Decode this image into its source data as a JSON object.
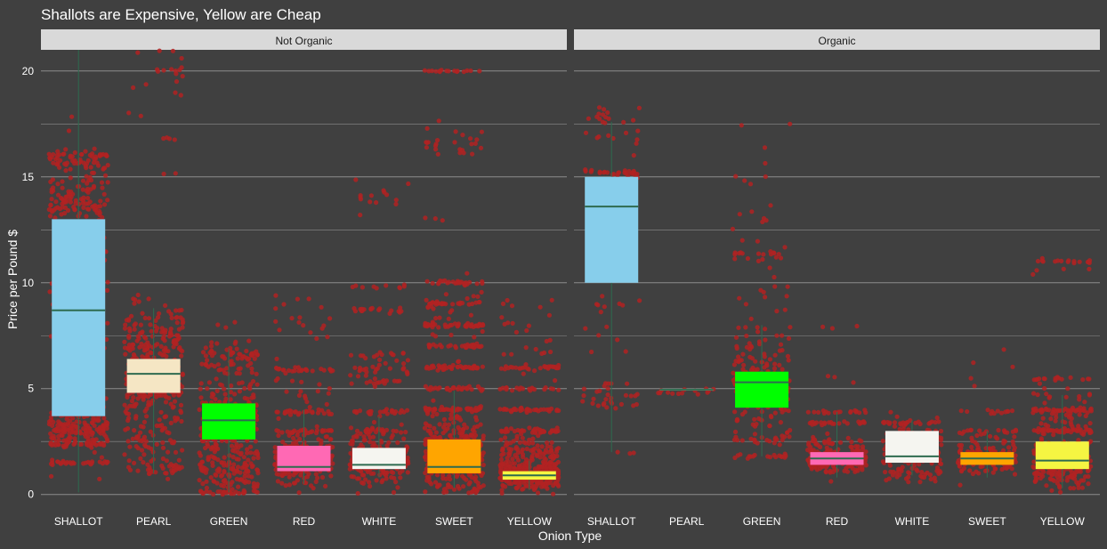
{
  "chart_data": {
    "type": "boxplot",
    "title": "Shallots are Expensive, Yellow are Cheap",
    "xlabel": "Onion Type",
    "ylabel": "Price per Pound $",
    "ylim": [
      -0.6,
      21.0
    ],
    "yticks": [
      0,
      5,
      10,
      15,
      20
    ],
    "grid": true,
    "categories": [
      "SHALLOT",
      "PEARL",
      "GREEN",
      "RED",
      "WHITE",
      "SWEET",
      "YELLOW"
    ],
    "colors": {
      "background": "#404040",
      "strip": "#d9d9d9",
      "grid": "#8c8c8c",
      "points": "#b22222",
      "median": "#2e6b4f",
      "whisker": "#2e6b4f",
      "fills": {
        "SHALLOT": "#87ceeb",
        "PEARL": "#f5e6c4",
        "GREEN": "#00ff00",
        "RED": "#ff69b4",
        "WHITE": "#f5f5f0",
        "SWEET": "#ffa500",
        "YELLOW": "#f5f542"
      }
    },
    "panels": [
      {
        "label": "Not Organic",
        "boxes": [
          {
            "category": "SHALLOT",
            "lower": 0.1,
            "q1": 3.7,
            "median": 8.7,
            "q3": 13.0,
            "upper": 21.0
          },
          {
            "category": "PEARL",
            "lower": 1.0,
            "q1": 4.8,
            "median": 5.7,
            "q3": 6.4,
            "upper": 8.8
          },
          {
            "category": "GREEN",
            "lower": 0.1,
            "q1": 2.6,
            "median": 3.5,
            "q3": 4.3,
            "upper": 6.9
          },
          {
            "category": "RED",
            "lower": 0.5,
            "q1": 1.1,
            "median": 1.3,
            "q3": 2.3,
            "upper": 4.0
          },
          {
            "category": "WHITE",
            "lower": 0.8,
            "q1": 1.2,
            "median": 1.4,
            "q3": 2.2,
            "upper": 3.7
          },
          {
            "category": "SWEET",
            "lower": 0.3,
            "q1": 1.0,
            "median": 1.3,
            "q3": 2.6,
            "upper": 4.9
          },
          {
            "category": "YELLOW",
            "lower": 0.2,
            "q1": 0.7,
            "median": 0.9,
            "q3": 1.1,
            "upper": 1.6
          }
        ],
        "points": [
          {
            "category": "SHALLOT",
            "clusters": [
              [
                1.5,
                0.05,
                30
              ],
              [
                2.4,
                0.1,
                35
              ],
              [
                3.1,
                0.4,
                140
              ],
              [
                4.2,
                0.3,
                40
              ],
              [
                10.0,
                3.0,
                120
              ],
              [
                13.5,
                0.3,
                50
              ],
              [
                14.5,
                0.5,
                45
              ],
              [
                15.8,
                0.25,
                60
              ]
            ]
          },
          {
            "category": "PEARL",
            "clusters": [
              [
                5.6,
                1.4,
                260
              ],
              [
                2.5,
                0.7,
                60
              ],
              [
                1.3,
                0.2,
                22
              ],
              [
                7.8,
                0.8,
                70
              ],
              [
                19.2,
                0.6,
                8
              ],
              [
                20.1,
                0.1,
                7
              ],
              [
                16.8,
                0.05,
                4
              ],
              [
                20.9,
                0.1,
                3
              ],
              [
                15.2,
                0.1,
                2
              ],
              [
                17.9,
                0.1,
                2
              ]
            ]
          },
          {
            "category": "GREEN",
            "clusters": [
              [
                3.3,
                1.3,
                260
              ],
              [
                1.0,
                0.5,
                90
              ],
              [
                0.1,
                0.05,
                22
              ],
              [
                6.4,
                0.4,
                60
              ],
              [
                8.0,
                0.1,
                3
              ]
            ]
          },
          {
            "category": "RED",
            "clusters": [
              [
                1.4,
                0.45,
                180
              ],
              [
                2.5,
                0.3,
                40
              ],
              [
                3.0,
                0.05,
                24
              ],
              [
                3.9,
                0.05,
                26
              ],
              [
                5.9,
                0.05,
                24
              ],
              [
                4.8,
                0.6,
                20
              ],
              [
                8.3,
                0.7,
                16
              ],
              [
                7.4,
                0.05,
                2
              ]
            ]
          },
          {
            "category": "WHITE",
            "clusters": [
              [
                1.5,
                0.5,
                170
              ],
              [
                2.6,
                0.4,
                40
              ],
              [
                3.0,
                0.05,
                20
              ],
              [
                3.9,
                0.05,
                22
              ],
              [
                5.9,
                0.3,
                30
              ],
              [
                6.6,
                0.05,
                12
              ],
              [
                8.7,
                0.05,
                18
              ],
              [
                9.8,
                0.05,
                10
              ],
              [
                14.2,
                0.4,
                14
              ],
              [
                5.3,
                0.05,
                12
              ]
            ]
          },
          {
            "category": "SWEET",
            "clusters": [
              [
                1.4,
                0.7,
                230
              ],
              [
                3.0,
                0.6,
                90
              ],
              [
                4.0,
                0.05,
                40
              ],
              [
                5.0,
                0.05,
                30
              ],
              [
                6.0,
                0.05,
                45
              ],
              [
                7.0,
                0.05,
                30
              ],
              [
                8.0,
                0.05,
                40
              ],
              [
                9.0,
                0.05,
                25
              ],
              [
                10.0,
                0.05,
                25
              ],
              [
                8.5,
                0.8,
                30
              ],
              [
                16.7,
                0.4,
                25
              ],
              [
                20.0,
                0.03,
                16
              ],
              [
                13.0,
                0.05,
                3
              ]
            ]
          },
          {
            "category": "YELLOW",
            "clusters": [
              [
                0.9,
                0.35,
                270
              ],
              [
                2.0,
                0.5,
                110
              ],
              [
                3.0,
                0.05,
                40
              ],
              [
                4.0,
                0.05,
                35
              ],
              [
                5.0,
                0.05,
                20
              ],
              [
                6.0,
                0.05,
                30
              ],
              [
                7.0,
                0.7,
                20
              ],
              [
                8.9,
                0.3,
                6
              ]
            ]
          }
        ]
      },
      {
        "label": "Organic",
        "boxes": [
          {
            "category": "SHALLOT",
            "lower": 2.0,
            "q1": 10.0,
            "median": 13.6,
            "q3": 15.0,
            "upper": 17.6
          },
          {
            "category": "PEARL",
            "lower": 4.95,
            "q1": 4.95,
            "median": 4.95,
            "q3": 4.95,
            "upper": 4.95
          },
          {
            "category": "GREEN",
            "lower": 1.8,
            "q1": 4.1,
            "median": 5.3,
            "q3": 5.8,
            "upper": 8.0
          },
          {
            "category": "RED",
            "lower": 0.8,
            "q1": 1.4,
            "median": 1.7,
            "q3": 2.0,
            "upper": 3.9
          },
          {
            "category": "WHITE",
            "lower": 0.9,
            "q1": 1.5,
            "median": 1.8,
            "q3": 3.0,
            "upper": 3.5
          },
          {
            "category": "SWEET",
            "lower": 0.8,
            "q1": 1.4,
            "median": 1.7,
            "q3": 2.0,
            "upper": 3.0
          },
          {
            "category": "YELLOW",
            "lower": 0.3,
            "q1": 1.2,
            "median": 1.6,
            "q3": 2.5,
            "upper": 4.7
          }
        ],
        "points": [
          {
            "category": "SHALLOT",
            "clusters": [
              [
                2.0,
                0.05,
                3
              ],
              [
                4.6,
                0.4,
                30
              ],
              [
                8.5,
                0.7,
                12
              ],
              [
                6.7,
                0.05,
                2
              ],
              [
                15.2,
                0.1,
                26
              ],
              [
                17.2,
                0.6,
                25
              ],
              [
                13.5,
                0.3,
                8
              ]
            ]
          },
          {
            "category": "PEARL",
            "clusters": [
              [
                4.85,
                0.1,
                14
              ]
            ]
          },
          {
            "category": "GREEN",
            "clusters": [
              [
                1.8,
                0.05,
                18
              ],
              [
                2.6,
                0.1,
                20
              ],
              [
                4.8,
                1.2,
                110
              ],
              [
                6.5,
                0.8,
                40
              ],
              [
                9.5,
                1.5,
                25
              ],
              [
                11.4,
                0.05,
                12
              ],
              [
                13.0,
                1.0,
                10
              ],
              [
                14.8,
                0.2,
                4
              ],
              [
                17.5,
                0.05,
                2
              ],
              [
                16.4,
                0.05,
                1
              ]
            ]
          },
          {
            "category": "RED",
            "clusters": [
              [
                1.6,
                0.35,
                150
              ],
              [
                2.4,
                0.2,
                25
              ],
              [
                3.4,
                0.05,
                25
              ],
              [
                3.9,
                0.05,
                18
              ],
              [
                5.5,
                0.2,
                3
              ],
              [
                7.9,
                0.05,
                3
              ]
            ]
          },
          {
            "category": "WHITE",
            "clusters": [
              [
                1.7,
                0.5,
                70
              ],
              [
                1.0,
                0.1,
                20
              ],
              [
                2.8,
                0.4,
                40
              ],
              [
                3.4,
                0.05,
                20
              ]
            ]
          },
          {
            "category": "SWEET",
            "clusters": [
              [
                1.6,
                0.35,
                130
              ],
              [
                2.5,
                0.4,
                30
              ],
              [
                3.0,
                0.05,
                14
              ],
              [
                3.9,
                0.05,
                12
              ],
              [
                5.6,
                0.3,
                4
              ],
              [
                6.9,
                0.05,
                1
              ]
            ]
          },
          {
            "category": "YELLOW",
            "clusters": [
              [
                1.1,
                0.4,
                140
              ],
              [
                2.0,
                0.3,
                70
              ],
              [
                3.0,
                0.05,
                40
              ],
              [
                4.0,
                0.05,
                35
              ],
              [
                3.5,
                0.4,
                40
              ],
              [
                5.5,
                0.05,
                14
              ],
              [
                4.8,
                0.3,
                15
              ],
              [
                11.0,
                0.05,
                16
              ],
              [
                10.6,
                0.1,
                4
              ]
            ]
          }
        ]
      }
    ]
  }
}
